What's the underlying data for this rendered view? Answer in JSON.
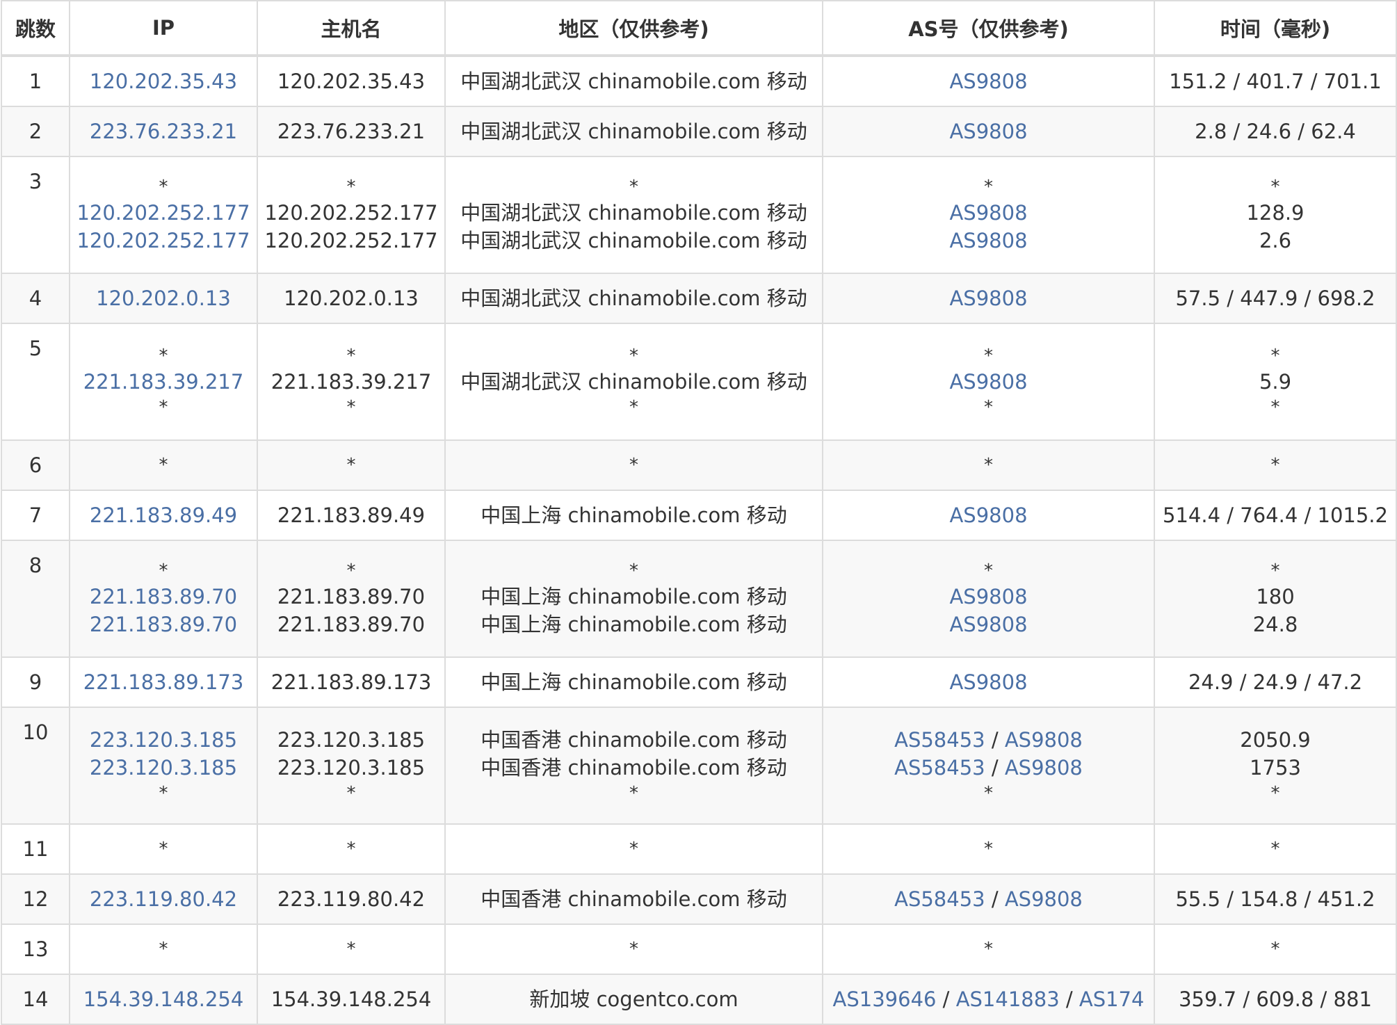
{
  "columns": [
    "跳数",
    "IP",
    "主机名",
    "地区（仅供参考)",
    "AS号（仅供参考)",
    "时间（毫秒)"
  ],
  "rows": [
    {
      "hop": "1",
      "lines": [
        {
          "ip": "120.202.35.43",
          "host": "120.202.35.43",
          "region": "中国湖北武汉 chinamobile.com 移动",
          "as": [
            "AS9808"
          ],
          "time": "151.2 / 401.7 / 701.1"
        }
      ]
    },
    {
      "hop": "2",
      "lines": [
        {
          "ip": "223.76.233.21",
          "host": "223.76.233.21",
          "region": "中国湖北武汉 chinamobile.com 移动",
          "as": [
            "AS9808"
          ],
          "time": "2.8 / 24.6 / 62.4"
        }
      ]
    },
    {
      "hop": "3",
      "lines": [
        {
          "ip": "*",
          "host": "*",
          "region": "*",
          "as": [
            "*"
          ],
          "time": "*"
        },
        {
          "ip": "120.202.252.177",
          "host": "120.202.252.177",
          "region": "中国湖北武汉 chinamobile.com 移动",
          "as": [
            "AS9808"
          ],
          "time": "128.9"
        },
        {
          "ip": "120.202.252.177",
          "host": "120.202.252.177",
          "region": "中国湖北武汉 chinamobile.com 移动",
          "as": [
            "AS9808"
          ],
          "time": "2.6"
        }
      ]
    },
    {
      "hop": "4",
      "lines": [
        {
          "ip": "120.202.0.13",
          "host": "120.202.0.13",
          "region": "中国湖北武汉 chinamobile.com 移动",
          "as": [
            "AS9808"
          ],
          "time": "57.5 / 447.9 / 698.2"
        }
      ]
    },
    {
      "hop": "5",
      "lines": [
        {
          "ip": "*",
          "host": "*",
          "region": "*",
          "as": [
            "*"
          ],
          "time": "*"
        },
        {
          "ip": "221.183.39.217",
          "host": "221.183.39.217",
          "region": "中国湖北武汉 chinamobile.com 移动",
          "as": [
            "AS9808"
          ],
          "time": "5.9"
        },
        {
          "ip": "*",
          "host": "*",
          "region": "*",
          "as": [
            "*"
          ],
          "time": "*"
        }
      ]
    },
    {
      "hop": "6",
      "lines": [
        {
          "ip": "*",
          "host": "*",
          "region": "*",
          "as": [
            "*"
          ],
          "time": "*"
        }
      ]
    },
    {
      "hop": "7",
      "lines": [
        {
          "ip": "221.183.89.49",
          "host": "221.183.89.49",
          "region": "中国上海 chinamobile.com 移动",
          "as": [
            "AS9808"
          ],
          "time": "514.4 / 764.4 / 1015.2"
        }
      ]
    },
    {
      "hop": "8",
      "lines": [
        {
          "ip": "*",
          "host": "*",
          "region": "*",
          "as": [
            "*"
          ],
          "time": "*"
        },
        {
          "ip": "221.183.89.70",
          "host": "221.183.89.70",
          "region": "中国上海 chinamobile.com 移动",
          "as": [
            "AS9808"
          ],
          "time": "180"
        },
        {
          "ip": "221.183.89.70",
          "host": "221.183.89.70",
          "region": "中国上海 chinamobile.com 移动",
          "as": [
            "AS9808"
          ],
          "time": "24.8"
        }
      ]
    },
    {
      "hop": "9",
      "lines": [
        {
          "ip": "221.183.89.173",
          "host": "221.183.89.173",
          "region": "中国上海 chinamobile.com 移动",
          "as": [
            "AS9808"
          ],
          "time": "24.9 / 24.9 / 47.2"
        }
      ]
    },
    {
      "hop": "10",
      "lines": [
        {
          "ip": "223.120.3.185",
          "host": "223.120.3.185",
          "region": "中国香港 chinamobile.com 移动",
          "as": [
            "AS58453",
            "AS9808"
          ],
          "time": "2050.9"
        },
        {
          "ip": "223.120.3.185",
          "host": "223.120.3.185",
          "region": "中国香港 chinamobile.com 移动",
          "as": [
            "AS58453",
            "AS9808"
          ],
          "time": "1753"
        },
        {
          "ip": "*",
          "host": "*",
          "region": "*",
          "as": [
            "*"
          ],
          "time": "*"
        }
      ]
    },
    {
      "hop": "11",
      "lines": [
        {
          "ip": "*",
          "host": "*",
          "region": "*",
          "as": [
            "*"
          ],
          "time": "*"
        }
      ]
    },
    {
      "hop": "12",
      "lines": [
        {
          "ip": "223.119.80.42",
          "host": "223.119.80.42",
          "region": "中国香港 chinamobile.com 移动",
          "as": [
            "AS58453",
            "AS9808"
          ],
          "time": "55.5 / 154.8 / 451.2"
        }
      ]
    },
    {
      "hop": "13",
      "lines": [
        {
          "ip": "*",
          "host": "*",
          "region": "*",
          "as": [
            "*"
          ],
          "time": "*"
        }
      ]
    },
    {
      "hop": "14",
      "lines": [
        {
          "ip": "154.39.148.254",
          "host": "154.39.148.254",
          "region": "新加坡 cogentco.com",
          "as": [
            "AS139646",
            "AS141883",
            "AS174"
          ],
          "time": "359.7 / 609.8 / 881"
        }
      ]
    }
  ],
  "colors": {
    "link": "#4a6fa5",
    "text": "#333333",
    "border": "#dcdcdc",
    "stripe": "#f8f8f8"
  }
}
